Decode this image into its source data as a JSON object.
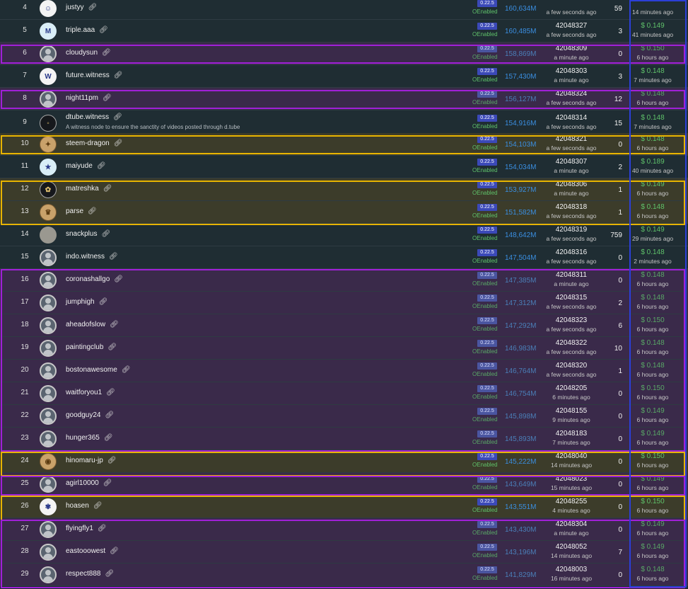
{
  "rows": [
    {
      "rank": "4",
      "name": "justyy",
      "votes": "160,634M",
      "block_ago": "a few seconds ago",
      "missed": "59",
      "price_ago": "14 minutes ago",
      "version": "0.22.5",
      "status": "Enabled"
    },
    {
      "rank": "5",
      "name": "triple.aaa",
      "version": "0.22.5",
      "status": "Enabled",
      "votes": "160,485M",
      "block": "42048327",
      "block_ago": "a few seconds ago",
      "missed": "3",
      "price": "$ 0.149",
      "price_ago": "41 minutes ago"
    },
    {
      "rank": "6",
      "name": "cloudysun",
      "version": "0.22.5",
      "status": "Enabled",
      "votes": "158,869M",
      "block": "42048309",
      "block_ago": "a minute ago",
      "missed": "0",
      "price": "$ 0.150",
      "price_ago": "6 hours ago"
    },
    {
      "rank": "7",
      "name": "future.witness",
      "version": "0.22.5",
      "status": "Enabled",
      "votes": "157,430M",
      "block": "42048303",
      "block_ago": "a minute ago",
      "missed": "3",
      "price": "$ 0.148",
      "price_ago": "7 minutes ago"
    },
    {
      "rank": "8",
      "name": "night11pm",
      "version": "0.22.5",
      "status": "Enabled",
      "votes": "156,127M",
      "block": "42048324",
      "block_ago": "a few seconds ago",
      "missed": "12",
      "price": "$ 0.148",
      "price_ago": "6 hours ago"
    },
    {
      "rank": "9",
      "name": "dtube.witness",
      "description": "A witness node to ensure the sanctity of videos posted through d.tube",
      "version": "0.22.5",
      "status": "Enabled",
      "votes": "154,916M",
      "block": "42048314",
      "block_ago": "a few seconds ago",
      "missed": "15",
      "price": "$ 0.148",
      "price_ago": "7 minutes ago"
    },
    {
      "rank": "10",
      "name": "steem-dragon",
      "version": "0.22.5",
      "status": "Enabled",
      "votes": "154,103M",
      "block": "42048321",
      "block_ago": "a few seconds ago",
      "missed": "0",
      "price": "$ 0.148",
      "price_ago": "6 hours ago"
    },
    {
      "rank": "11",
      "name": "maiyude",
      "version": "0.22.5",
      "status": "Enabled",
      "votes": "154,034M",
      "block": "42048307",
      "block_ago": "a minute ago",
      "missed": "2",
      "price": "$ 0.189",
      "price_ago": "40 minutes ago"
    },
    {
      "rank": "12",
      "name": "matreshka",
      "version": "0.22.5",
      "status": "Enabled",
      "votes": "153,927M",
      "block": "42048306",
      "block_ago": "a minute ago",
      "missed": "1",
      "price": "$ 0.149",
      "price_ago": "6 hours ago"
    },
    {
      "rank": "13",
      "name": "parse",
      "version": "0.22.5",
      "status": "Enabled",
      "votes": "151,582M",
      "block": "42048318",
      "block_ago": "a few seconds ago",
      "missed": "1",
      "price": "$ 0.148",
      "price_ago": "6 hours ago"
    },
    {
      "rank": "14",
      "name": "snackplus",
      "version": "0.22.5",
      "status": "Enabled",
      "votes": "148,642M",
      "block": "42048319",
      "block_ago": "a few seconds ago",
      "missed": "759",
      "price": "$ 0.149",
      "price_ago": "29 minutes ago"
    },
    {
      "rank": "15",
      "name": "indo.witness",
      "version": "0.22.5",
      "status": "Enabled",
      "votes": "147,504M",
      "block": "42048316",
      "block_ago": "a few seconds ago",
      "missed": "0",
      "price": "$ 0.148",
      "price_ago": "2 minutes ago"
    },
    {
      "rank": "16",
      "name": "coronashallgo",
      "version": "0.22.5",
      "status": "Enabled",
      "votes": "147,385M",
      "block": "42048311",
      "block_ago": "a minute ago",
      "missed": "0",
      "price": "$ 0.148",
      "price_ago": "6 hours ago"
    },
    {
      "rank": "17",
      "name": "jumphigh",
      "version": "0.22.5",
      "status": "Enabled",
      "votes": "147,312M",
      "block": "42048315",
      "block_ago": "a few seconds ago",
      "missed": "2",
      "price": "$ 0.148",
      "price_ago": "6 hours ago"
    },
    {
      "rank": "18",
      "name": "aheadofslow",
      "version": "0.22.5",
      "status": "Enabled",
      "votes": "147,292M",
      "block": "42048323",
      "block_ago": "a few seconds ago",
      "missed": "6",
      "price": "$ 0.150",
      "price_ago": "6 hours ago"
    },
    {
      "rank": "19",
      "name": "paintingclub",
      "version": "0.22.5",
      "status": "Enabled",
      "votes": "146,983M",
      "block": "42048322",
      "block_ago": "a few seconds ago",
      "missed": "10",
      "price": "$ 0.148",
      "price_ago": "6 hours ago"
    },
    {
      "rank": "20",
      "name": "bostonawesome",
      "version": "0.22.5",
      "status": "Enabled",
      "votes": "146,764M",
      "block": "42048320",
      "block_ago": "a few seconds ago",
      "missed": "1",
      "price": "$ 0.148",
      "price_ago": "6 hours ago"
    },
    {
      "rank": "21",
      "name": "waitforyou1",
      "version": "0.22.5",
      "status": "Enabled",
      "votes": "146,754M",
      "block": "42048205",
      "block_ago": "6 minutes ago",
      "missed": "0",
      "price": "$ 0.150",
      "price_ago": "6 hours ago"
    },
    {
      "rank": "22",
      "name": "goodguy24",
      "version": "0.22.5",
      "status": "Enabled",
      "votes": "145,898M",
      "block": "42048155",
      "block_ago": "9 minutes ago",
      "missed": "0",
      "price": "$ 0.149",
      "price_ago": "6 hours ago"
    },
    {
      "rank": "23",
      "name": "hunger365",
      "version": "0.22.5",
      "status": "Enabled",
      "votes": "145,893M",
      "block": "42048183",
      "block_ago": "7 minutes ago",
      "missed": "0",
      "price": "$ 0.149",
      "price_ago": "6 hours ago"
    },
    {
      "rank": "24",
      "name": "hinomaru-jp",
      "version": "0.22.5",
      "status": "Enabled",
      "votes": "145,222M",
      "block": "42048040",
      "block_ago": "14 minutes ago",
      "missed": "0",
      "price": "$ 0.150",
      "price_ago": "6 hours ago"
    },
    {
      "rank": "25",
      "name": "agirl10000",
      "version": "0.22.5",
      "status": "Enabled",
      "votes": "143,649M",
      "block": "42048023",
      "block_ago": "15 minutes ago",
      "missed": "0",
      "price": "$ 0.149",
      "price_ago": "6 hours ago"
    },
    {
      "rank": "26",
      "name": "hoasen",
      "version": "0.22.5",
      "status": "Enabled",
      "votes": "143,551M",
      "block": "42048255",
      "block_ago": "4 minutes ago",
      "missed": "0",
      "price": "$ 0.150",
      "price_ago": "6 hours ago"
    },
    {
      "rank": "27",
      "name": "flyingfly1",
      "version": "0.22.5",
      "status": "Enabled",
      "votes": "143,430M",
      "block": "42048304",
      "block_ago": "a minute ago",
      "missed": "0",
      "price": "$ 0.149",
      "price_ago": "6 hours ago"
    },
    {
      "rank": "28",
      "name": "eastooowest",
      "version": "0.22.5",
      "status": "Enabled",
      "votes": "143,196M",
      "block": "42048052",
      "block_ago": "14 minutes ago",
      "missed": "7",
      "price": "$ 0.149",
      "price_ago": "6 hours ago"
    },
    {
      "rank": "29",
      "name": "respect888",
      "version": "0.22.5",
      "status": "Enabled",
      "votes": "141,829M",
      "block": "42048003",
      "block_ago": "16 minutes ago",
      "missed": "0",
      "price": "$ 0.148",
      "price_ago": "6 hours ago"
    }
  ],
  "icons": {
    "link": "link-icon",
    "status_dot": "status-circle-icon"
  },
  "colors": {
    "votes": "#3a8ee0",
    "enabled": "#5fc26a",
    "price": "#5fc26a",
    "version_badge": "#3b49b8",
    "highlight_purple": "#a020d8",
    "highlight_gold": "#e8b400",
    "highlight_blue": "#2b3fd8"
  }
}
